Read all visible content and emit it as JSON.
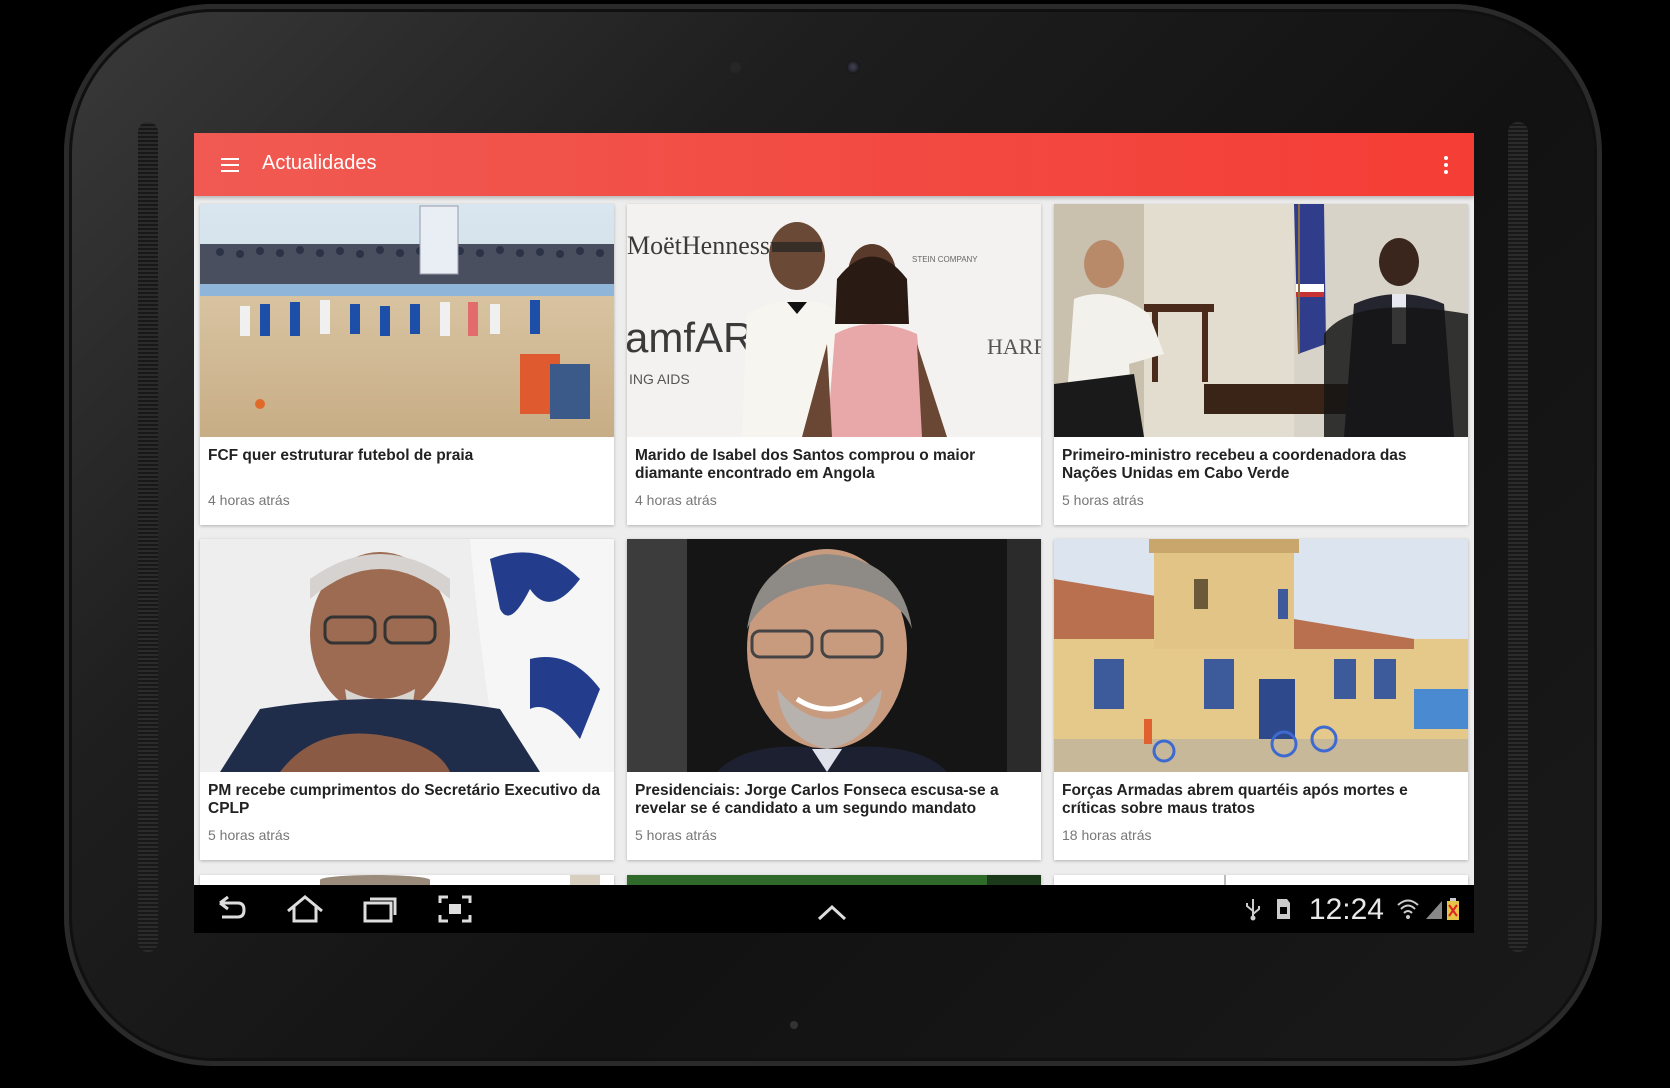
{
  "app": {
    "title": "Actualidades"
  },
  "articles": [
    {
      "headline": "FCF quer estruturar futebol de praia",
      "time": "4 horas atrás"
    },
    {
      "headline": "Marido de Isabel dos Santos comprou o maior diamante encontrado em Angola",
      "time": "4 horas atrás"
    },
    {
      "headline": "Primeiro-ministro recebeu a coordenadora das Nações Unidas em Cabo Verde",
      "time": "5 horas atrás"
    },
    {
      "headline": "PM recebe cumprimentos do Secretário Executivo da CPLP",
      "time": "5 horas atrás"
    },
    {
      "headline": "Presidenciais: Jorge Carlos Fonseca escusa-se a revelar se é candidato a um segundo mandato",
      "time": "5 horas atrás"
    },
    {
      "headline": "Forças Armadas abrem quartéis após mortes e críticas sobre maus tratos",
      "time": "18 horas atrás"
    }
  ],
  "image_text": {
    "brand_left": "MoëtHennessy",
    "brand_mid": "amfAR",
    "brand_sub": "ING AIDS",
    "brand_right": "HARR",
    "brand_company": "STEIN COMPANY"
  },
  "status_bar": {
    "clock": "12:24"
  },
  "colors": {
    "appbar": "#f44336",
    "nav_background": "#000000"
  },
  "icons": [
    "menu-icon",
    "overflow-icon",
    "back-icon",
    "home-icon",
    "recents-icon",
    "screenshot-icon",
    "expand-up-icon",
    "usb-icon",
    "sd-card-icon",
    "wifi-icon",
    "signal-icon",
    "battery-icon"
  ]
}
